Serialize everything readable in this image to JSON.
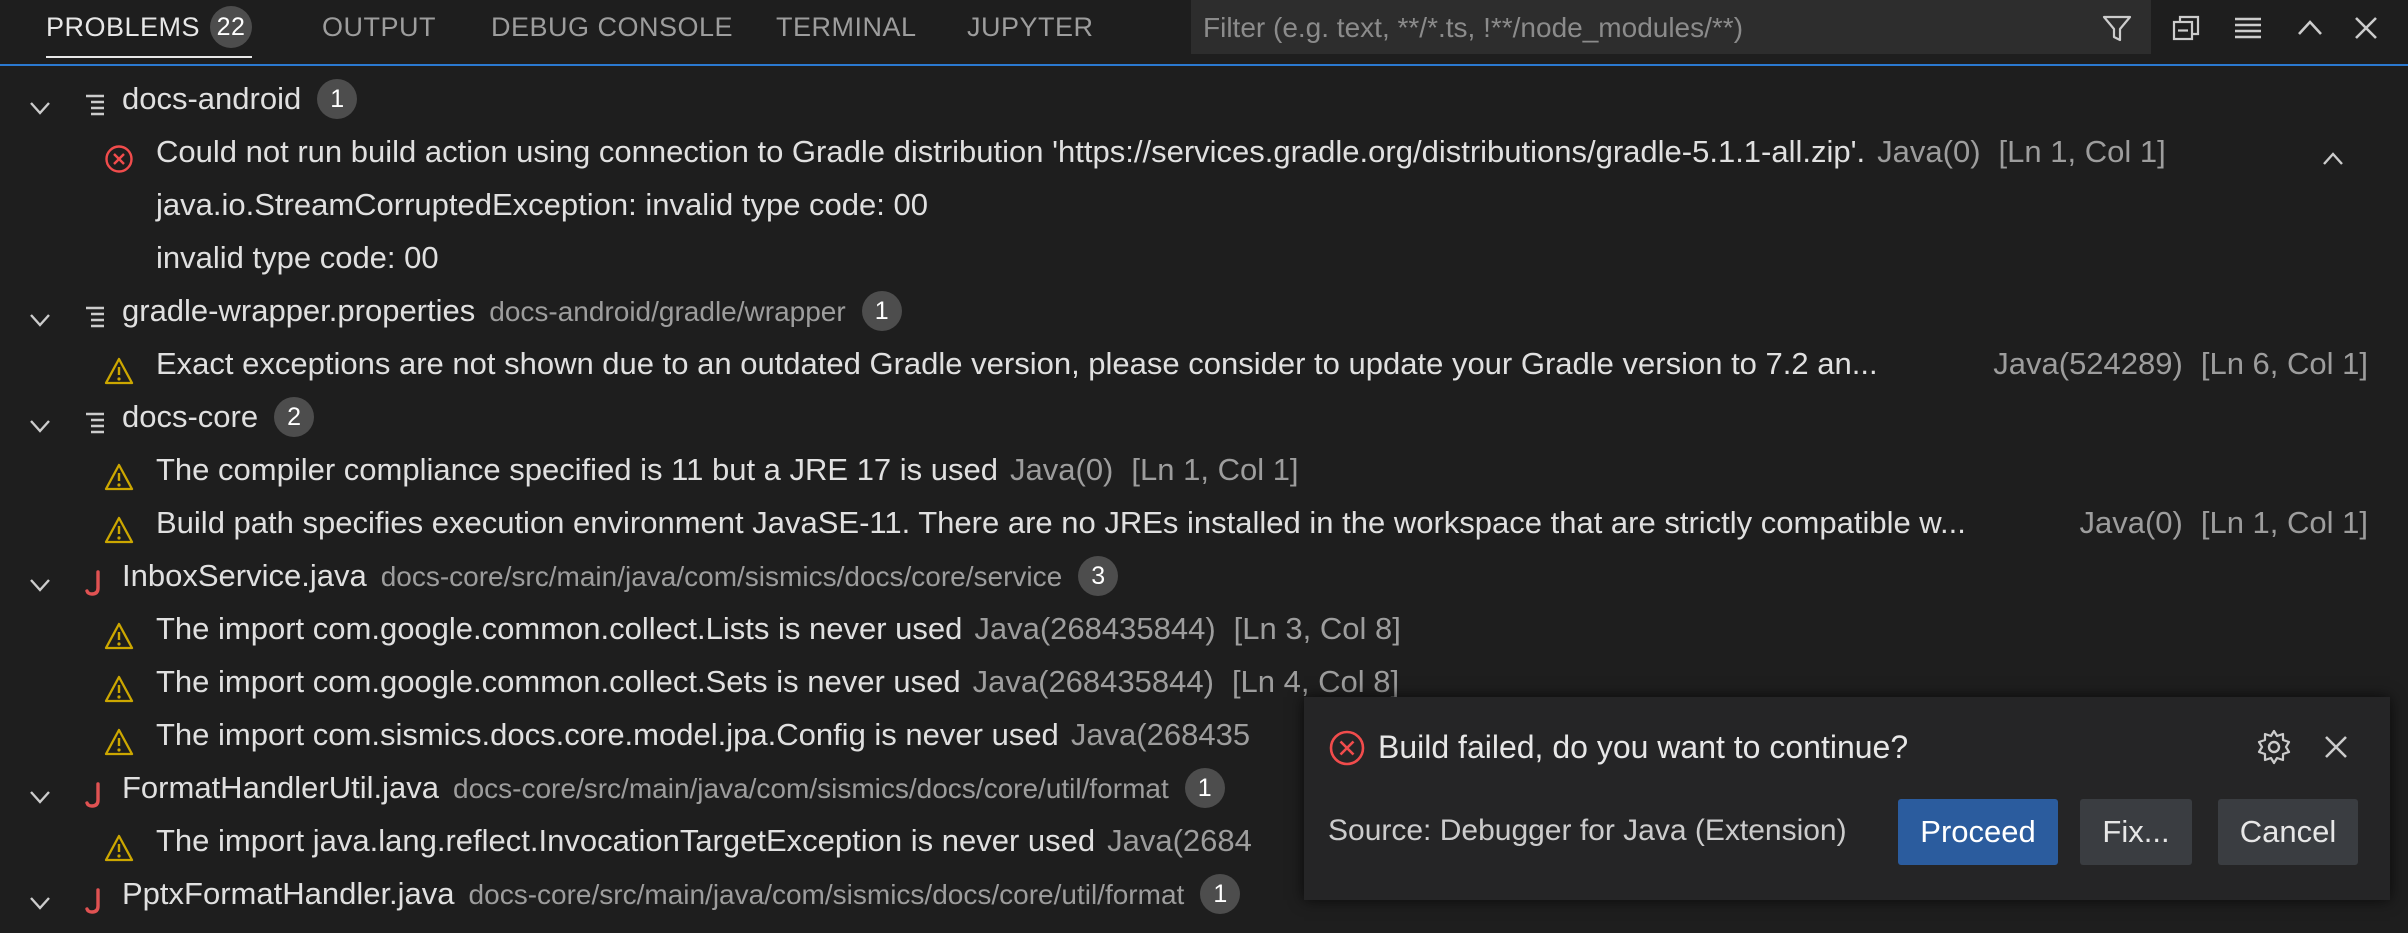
{
  "tabs": {
    "problems": "PROBLEMS",
    "problems_count": "22",
    "output": "OUTPUT",
    "debug_console": "DEBUG CONSOLE",
    "terminal": "TERMINAL",
    "jupyter": "JUPYTER"
  },
  "filter": {
    "placeholder": "Filter (e.g. text, **/*.ts, !**/node_modules/**)",
    "value": ""
  },
  "toolbar_icons": [
    "filter-icon",
    "collapse-all-icon",
    "view-as-list-icon",
    "chevron-up-icon",
    "close-icon"
  ],
  "colors": {
    "accent": "#2b79d0",
    "error": "#f14c4c",
    "warning": "#cca700",
    "java": "#e05252",
    "primary_button": "#2b5c9e"
  },
  "groups": [
    {
      "name": "docs-android",
      "path": "",
      "count": "1",
      "icon": "file-lines-icon",
      "items": [
        {
          "severity": "error",
          "message": "Could not run build action using connection to Gradle distribution 'https://services.gradle.org/distributions/gradle-5.1.1-all.zip'.",
          "source": "Java(0)",
          "location": "[Ln 1, Col 1]",
          "details": [
            "java.io.StreamCorruptedException: invalid type code: 00",
            "invalid type code: 00"
          ]
        }
      ]
    },
    {
      "name": "gradle-wrapper.properties",
      "path": "docs-android/gradle/wrapper",
      "count": "1",
      "icon": "file-lines-icon",
      "items": [
        {
          "severity": "warning",
          "message": "Exact exceptions are not shown due to an outdated Gradle version, please consider to update your Gradle version to 7.2 an...",
          "source": "Java(524289)",
          "location": "[Ln 6, Col 1]"
        }
      ]
    },
    {
      "name": "docs-core",
      "path": "",
      "count": "2",
      "icon": "file-lines-icon",
      "items": [
        {
          "severity": "warning",
          "message": "The compiler compliance specified is 11 but a JRE 17 is used",
          "source": "Java(0)",
          "location": "[Ln 1, Col 1]"
        },
        {
          "severity": "warning",
          "message": "Build path specifies execution environment JavaSE-11. There are no JREs installed in the workspace that are strictly compatible w...",
          "source": "Java(0)",
          "location": "[Ln 1, Col 1]"
        }
      ]
    },
    {
      "name": "InboxService.java",
      "path": "docs-core/src/main/java/com/sismics/docs/core/service",
      "count": "3",
      "icon": "java-icon",
      "items": [
        {
          "severity": "warning",
          "message": "The import com.google.common.collect.Lists is never used",
          "source": "Java(268435844)",
          "location": "[Ln 3, Col 8]"
        },
        {
          "severity": "warning",
          "message": "The import com.google.common.collect.Sets is never used",
          "source": "Java(268435844)",
          "location": "[Ln 4, Col 8]"
        },
        {
          "severity": "warning",
          "message": "The import com.sismics.docs.core.model.jpa.Config is never used",
          "source": "Java(268435",
          "location": ""
        }
      ]
    },
    {
      "name": "FormatHandlerUtil.java",
      "path": "docs-core/src/main/java/com/sismics/docs/core/util/format",
      "count": "1",
      "icon": "java-icon",
      "items": [
        {
          "severity": "warning",
          "message": "The import java.lang.reflect.InvocationTargetException is never used",
          "source": "Java(2684",
          "location": ""
        }
      ]
    },
    {
      "name": "PptxFormatHandler.java",
      "path": "docs-core/src/main/java/com/sismics/docs/core/util/format",
      "count": "1",
      "icon": "java-icon",
      "items": []
    }
  ],
  "notification": {
    "title": "Build failed, do you want to continue?",
    "source": "Source: Debugger for Java (Extension)",
    "buttons": {
      "proceed": "Proceed",
      "fix": "Fix...",
      "cancel": "Cancel"
    }
  }
}
